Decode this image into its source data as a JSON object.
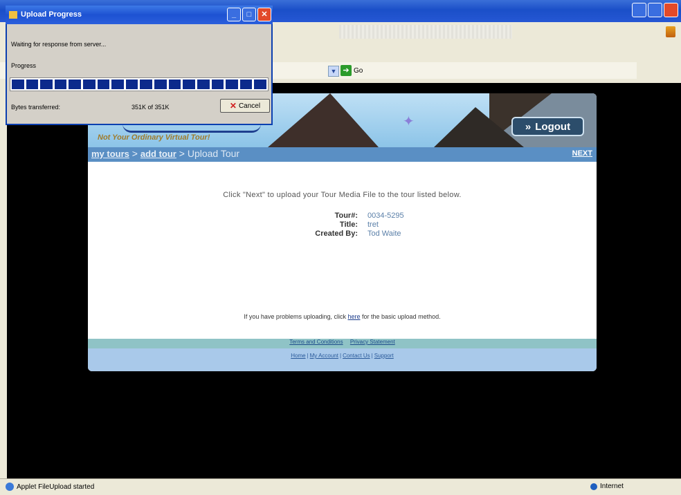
{
  "dialog": {
    "title": "Upload Progress",
    "status": "Waiting for response from server...",
    "progress_label": "Progress",
    "progress": 1.0,
    "bytes_label": "Bytes transferred:",
    "bytes_value": "351K of 351K",
    "cancel_label": "Cancel",
    "minimize_glyph": "_",
    "maximize_glyph": "□",
    "close_glyph": "✕"
  },
  "browser": {
    "go_label": "Go",
    "status_text": "Applet FileUpload started",
    "zone_text": "Internet"
  },
  "site": {
    "tagline": "Not Your Ordinary Virtual Tour!",
    "logout_label": "Logout",
    "logout_icon": "double-chevron-icon",
    "breadcrumb": {
      "item1": "my tours",
      "sep1": " > ",
      "item2": "add tour",
      "sep2": " > ",
      "current": "Upload Tour"
    },
    "next_label": "NEXT",
    "instruction": "Click \"Next\" to upload your Tour Media File to the tour listed below.",
    "info": {
      "tour_label": "Tour#:",
      "tour_value": "0034-5295",
      "title_label": "Title:",
      "title_value": "tret",
      "created_label": "Created By:",
      "created_value": "Tod Waite"
    },
    "problem_pre": "If you have problems uploading, click ",
    "problem_link": "here",
    "problem_post": " for the basic upload method.",
    "footer1": [
      "Terms and Conditions",
      "Privacy Statement"
    ],
    "footer2": [
      "Home",
      "My Account",
      "Contact Us",
      "Support"
    ]
  },
  "colors": {
    "navbar": "#5a8fc4",
    "progress_fill": "#0c2a8c",
    "logout_bg": "#2c4d6b"
  }
}
